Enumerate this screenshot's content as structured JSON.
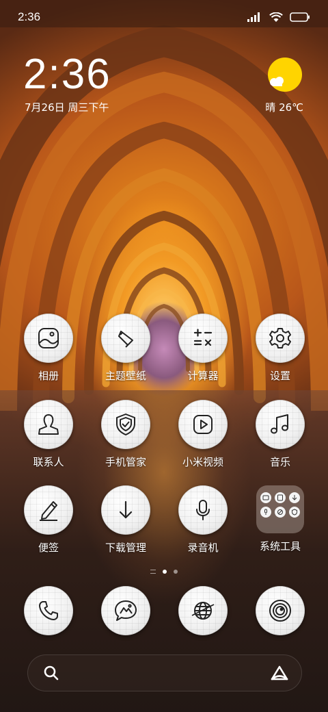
{
  "status_bar": {
    "time": "2:36",
    "icons": [
      "signal-icon",
      "wifi-icon",
      "battery-icon"
    ]
  },
  "clock_widget": {
    "time": "2:36",
    "date": "7月26日 周三下午"
  },
  "weather_widget": {
    "text": "晴 26℃",
    "icon": "sunny-cloud-icon",
    "sun_color": "#ffd400"
  },
  "apps": {
    "row1": [
      {
        "label": "相册",
        "icon": "gallery-icon"
      },
      {
        "label": "主题壁纸",
        "icon": "themes-icon"
      },
      {
        "label": "计算器",
        "icon": "calculator-icon"
      },
      {
        "label": "设置",
        "icon": "settings-icon"
      }
    ],
    "row2": [
      {
        "label": "联系人",
        "icon": "contacts-icon"
      },
      {
        "label": "手机管家",
        "icon": "security-icon"
      },
      {
        "label": "小米视频",
        "icon": "video-icon"
      },
      {
        "label": "音乐",
        "icon": "music-icon"
      }
    ],
    "row3": [
      {
        "label": "便签",
        "icon": "notes-icon"
      },
      {
        "label": "下载管理",
        "icon": "downloads-icon"
      },
      {
        "label": "录音机",
        "icon": "recorder-icon"
      },
      {
        "label": "系统工具",
        "icon": "folder-icon"
      }
    ]
  },
  "page_indicator": {
    "pages": 2,
    "current": 1
  },
  "dock": [
    "phone-icon",
    "messages-icon",
    "browser-icon",
    "camera-icon"
  ],
  "search_bar": {
    "left_icon": "search-icon",
    "right_icon": "assistant-icon"
  }
}
